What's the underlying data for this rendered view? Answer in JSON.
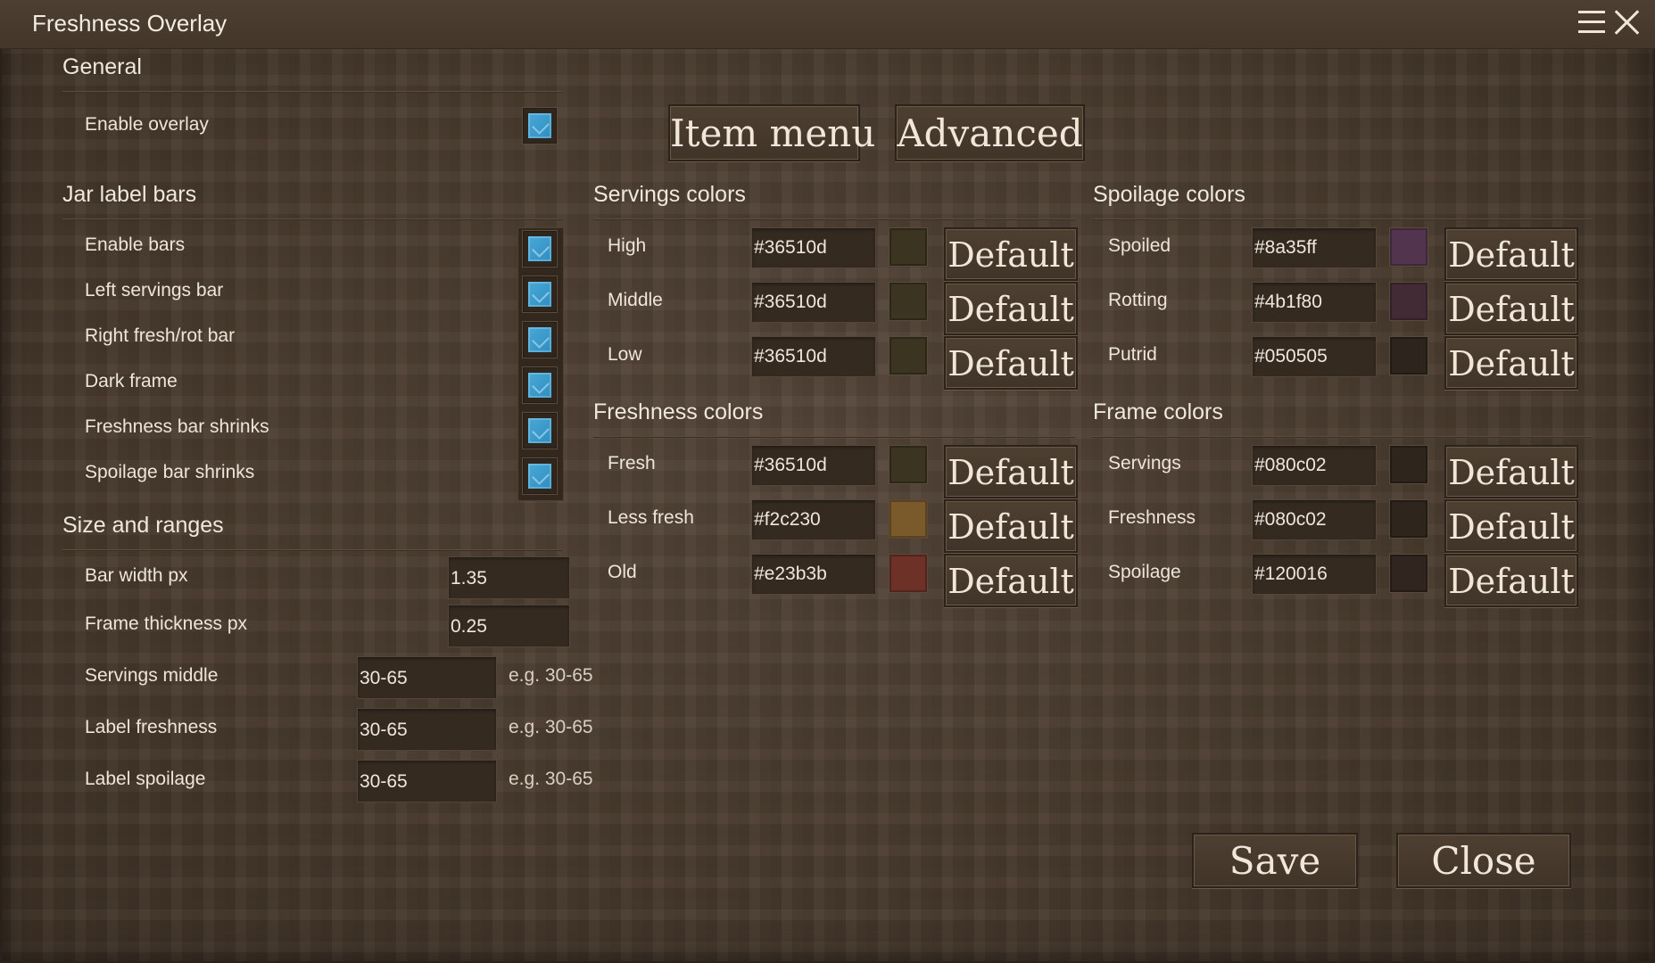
{
  "window": {
    "title": "Freshness Overlay"
  },
  "tabs": {
    "item_menu": "Item menu",
    "advanced": "Advanced"
  },
  "general": {
    "heading": "General",
    "enable_overlay": {
      "label": "Enable overlay",
      "checked": true
    }
  },
  "jar_label_bars": {
    "heading": "Jar label bars",
    "items": [
      {
        "label": "Enable bars",
        "checked": true
      },
      {
        "label": "Left servings bar",
        "checked": true
      },
      {
        "label": "Right fresh/rot bar",
        "checked": true
      },
      {
        "label": "Dark frame",
        "checked": true
      },
      {
        "label": "Freshness bar shrinks",
        "checked": true
      },
      {
        "label": "Spoilage bar shrinks",
        "checked": true
      }
    ]
  },
  "size_ranges": {
    "heading": "Size and ranges",
    "bar_width": {
      "label": "Bar width px",
      "value": "1.35"
    },
    "frame_thickness": {
      "label": "Frame thickness px",
      "value": "0.25"
    },
    "servings_middle": {
      "label": "Servings middle",
      "value": "30-65",
      "hint": "e.g. 30-65"
    },
    "label_freshness": {
      "label": "Label freshness",
      "value": "30-65",
      "hint": "e.g. 30-65"
    },
    "label_spoilage": {
      "label": "Label spoilage",
      "value": "30-65",
      "hint": "e.g. 30-65"
    }
  },
  "servings_colors": {
    "heading": "Servings colors",
    "rows": [
      {
        "label": "High",
        "value": "#36510d",
        "swatch": "#3b3420"
      },
      {
        "label": "Middle",
        "value": "#36510d",
        "swatch": "#3b3420"
      },
      {
        "label": "Low",
        "value": "#36510d",
        "swatch": "#3b3420"
      }
    ]
  },
  "freshness_colors": {
    "heading": "Freshness colors",
    "rows": [
      {
        "label": "Fresh",
        "value": "#36510d",
        "swatch": "#3b3420"
      },
      {
        "label": "Less fresh",
        "value": "#f2c230",
        "swatch": "#7a5a2b"
      },
      {
        "label": "Old",
        "value": "#e23b3b",
        "swatch": "#6e3128"
      }
    ]
  },
  "spoilage_colors": {
    "heading": "Spoilage colors",
    "rows": [
      {
        "label": "Spoiled",
        "value": "#8a35ff",
        "swatch": "#52344f"
      },
      {
        "label": "Rotting",
        "value": "#4b1f80",
        "swatch": "#432b36"
      },
      {
        "label": "Putrid",
        "value": "#050505",
        "swatch": "#2d241d"
      }
    ]
  },
  "frame_colors": {
    "heading": "Frame colors",
    "rows": [
      {
        "label": "Servings",
        "value": "#080c02",
        "swatch": "#2e251d"
      },
      {
        "label": "Freshness",
        "value": "#080c02",
        "swatch": "#2e251d"
      },
      {
        "label": "Spoilage",
        "value": "#120016",
        "swatch": "#30251f"
      }
    ]
  },
  "default_label": "Default",
  "footer": {
    "save": "Save",
    "close": "Close"
  },
  "icons": {
    "menu": "hamburger-menu-icon",
    "close": "close-icon"
  }
}
